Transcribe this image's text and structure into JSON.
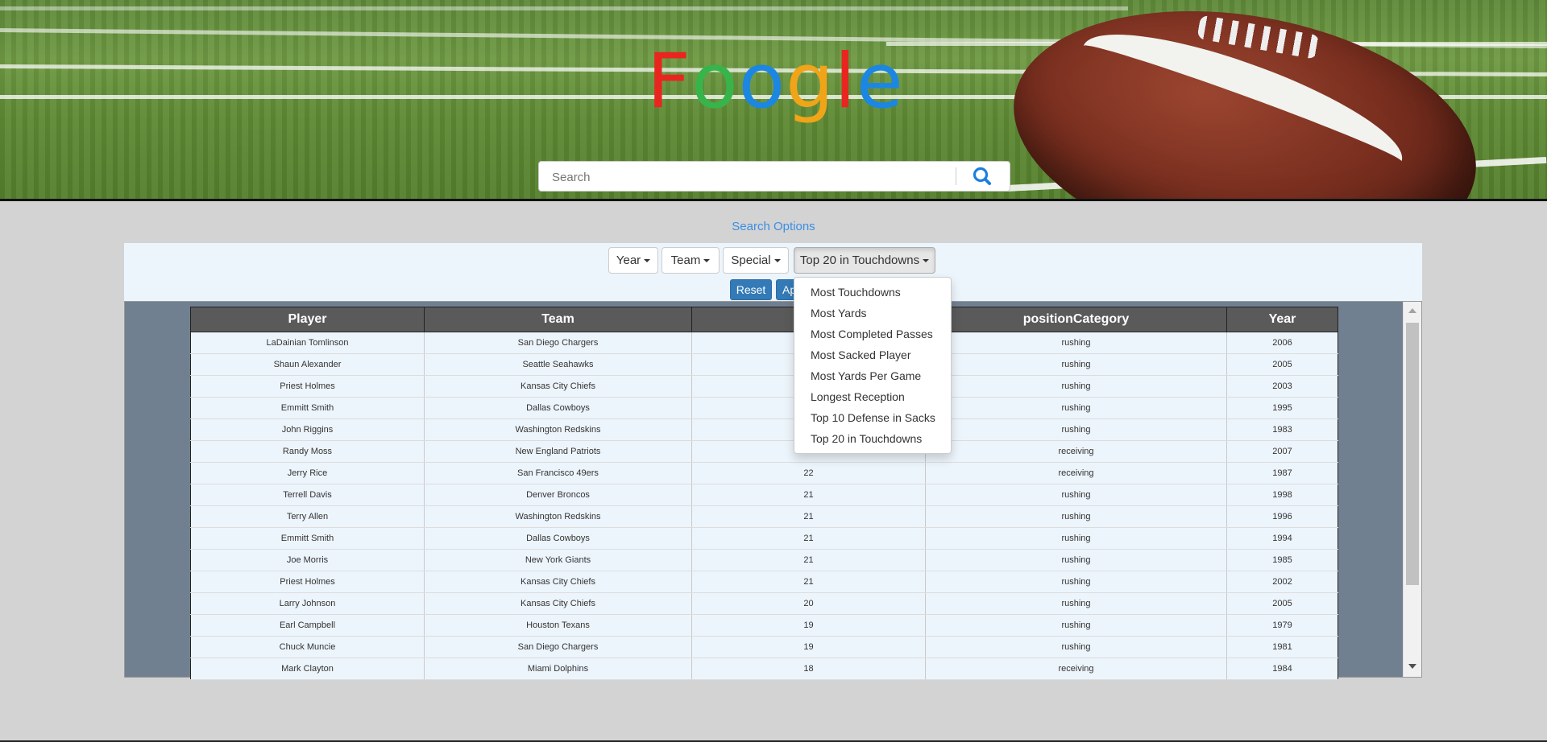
{
  "header": {
    "logo_letters": [
      {
        "char": "F",
        "color": "#e8261f"
      },
      {
        "char": "o",
        "color": "#37b54a"
      },
      {
        "char": "o",
        "color": "#1b87e3"
      },
      {
        "char": "g",
        "color": "#f0a418"
      },
      {
        "char": "l",
        "color": "#e8261f"
      },
      {
        "char": "e",
        "color": "#1b87e3"
      }
    ],
    "search_placeholder": "Search",
    "search_icon": "magnifier-icon"
  },
  "options": {
    "link_label": "Search Options",
    "dropdowns": [
      {
        "label": "Year"
      },
      {
        "label": "Team"
      },
      {
        "label": "Special"
      },
      {
        "label": "Top 20 in Touchdowns"
      }
    ],
    "reset_label": "Reset",
    "apply_label": "Ap"
  },
  "menu": {
    "items": [
      "Most Touchdowns",
      "Most Yards",
      "Most Completed Passes",
      "Most Sacked Player",
      "Most Yards Per Game",
      "Longest Reception",
      "Top 10 Defense in Sacks",
      "Top 20 in Touchdowns"
    ]
  },
  "table": {
    "headers": [
      "Player",
      "Team",
      "Touc",
      "positionCategory",
      "Year"
    ],
    "rows": [
      [
        "LaDainian Tomlinson",
        "San Diego Chargers",
        "",
        "rushing",
        "2006"
      ],
      [
        "Shaun Alexander",
        "Seattle Seahawks",
        "",
        "rushing",
        "2005"
      ],
      [
        "Priest Holmes",
        "Kansas City Chiefs",
        "",
        "rushing",
        "2003"
      ],
      [
        "Emmitt Smith",
        "Dallas Cowboys",
        "",
        "rushing",
        "1995"
      ],
      [
        "John Riggins",
        "Washington Redskins",
        "",
        "rushing",
        "1983"
      ],
      [
        "Randy Moss",
        "New England Patriots",
        "",
        "receiving",
        "2007"
      ],
      [
        "Jerry Rice",
        "San Francisco 49ers",
        "22",
        "receiving",
        "1987"
      ],
      [
        "Terrell Davis",
        "Denver Broncos",
        "21",
        "rushing",
        "1998"
      ],
      [
        "Terry Allen",
        "Washington Redskins",
        "21",
        "rushing",
        "1996"
      ],
      [
        "Emmitt Smith",
        "Dallas Cowboys",
        "21",
        "rushing",
        "1994"
      ],
      [
        "Joe Morris",
        "New York Giants",
        "21",
        "rushing",
        "1985"
      ],
      [
        "Priest Holmes",
        "Kansas City Chiefs",
        "21",
        "rushing",
        "2002"
      ],
      [
        "Larry Johnson",
        "Kansas City Chiefs",
        "20",
        "rushing",
        "2005"
      ],
      [
        "Earl Campbell",
        "Houston Texans",
        "19",
        "rushing",
        "1979"
      ],
      [
        "Chuck Muncie",
        "San Diego Chargers",
        "19",
        "rushing",
        "1981"
      ],
      [
        "Mark Clayton",
        "Miami Dolphins",
        "18",
        "receiving",
        "1984"
      ]
    ]
  }
}
